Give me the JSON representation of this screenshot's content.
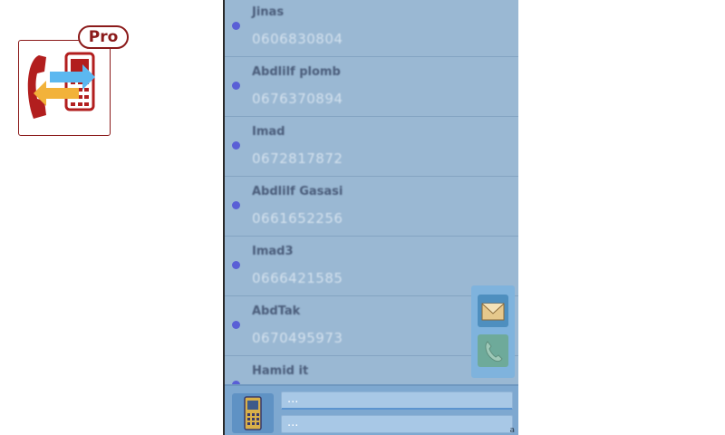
{
  "logo": {
    "badge_text": "Pro"
  },
  "contacts": [
    {
      "name": "Jinas",
      "number": "0606830804"
    },
    {
      "name": "Abdlilf plomb",
      "number": "0676370894"
    },
    {
      "name": "Imad",
      "number": "0672817872"
    },
    {
      "name": "Abdlilf Gasasi",
      "number": "0661652256"
    },
    {
      "name": "Imad3",
      "number": "0666421585"
    },
    {
      "name": "AbdTak",
      "number": "0670495973"
    },
    {
      "name": "Hamid it",
      "number": ""
    }
  ],
  "colors": {
    "screen_bg": "#9ab8d3",
    "bullet": "#5a5fd6",
    "logo_red": "#8b1a1a",
    "accent_blue": "#5c94cf"
  },
  "actions": [
    {
      "icon": "envelope-icon"
    },
    {
      "icon": "phone-icon"
    }
  ],
  "bottom_bar": {
    "icon": "mobile-phone-icon",
    "field1_placeholder": "...",
    "field2_placeholder": "...",
    "small_label": "a"
  }
}
